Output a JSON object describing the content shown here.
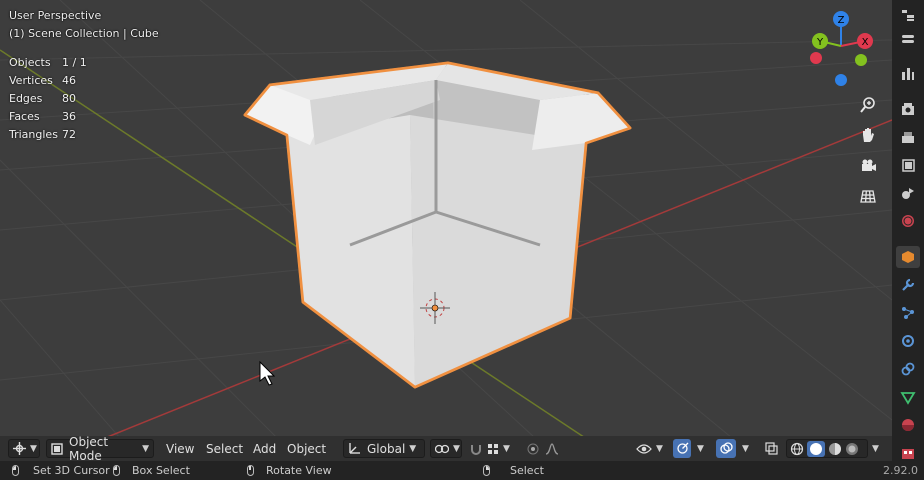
{
  "viewport": {
    "title": "User Perspective",
    "collection": "(1) Scene Collection | Cube",
    "stats": [
      {
        "label": "Objects",
        "value": "1 / 1"
      },
      {
        "label": "Vertices",
        "value": "46"
      },
      {
        "label": "Edges",
        "value": "80"
      },
      {
        "label": "Faces",
        "value": "36"
      },
      {
        "label": "Triangles",
        "value": "72"
      }
    ],
    "gizmo": {
      "z": "Z",
      "y": "Y",
      "x": "X"
    }
  },
  "header": {
    "mode": "Object Mode",
    "menus": [
      "View",
      "Select",
      "Add",
      "Object"
    ],
    "orientation": "Global"
  },
  "statusbar": {
    "left_click": "Set 3D Cursor",
    "left_drag": "Box Select",
    "middle": "Rotate View",
    "right": "Select",
    "version": "2.92.0"
  },
  "colors": {
    "background": "#3d3d3d",
    "selection_outline": "#f09040",
    "axis_x": "#a33a3a",
    "axis_y": "#6c7a2a",
    "gizmo_x": "#e0394e",
    "gizmo_y": "#83c11f",
    "gizmo_z": "#2f82e8",
    "header": "#303030",
    "statusbar": "#232323"
  },
  "icons": [
    "editor-type-icon",
    "object-mode-icon",
    "transform-orientation-icon",
    "pivot-icon",
    "snap-icon",
    "proportional-edit-icon",
    "visibility-icon",
    "gizmo-icon",
    "overlay-icon",
    "xray-icon",
    "wireframe-shading-icon",
    "solid-shading-icon",
    "material-shading-icon",
    "rendered-shading-icon",
    "zoom-icon",
    "hand-pan-icon",
    "camera-icon",
    "grid-icon",
    "tool-icon",
    "render-icon",
    "output-icon",
    "view-layer-icon",
    "scene-icon",
    "world-icon",
    "object-icon",
    "modifier-icon",
    "particles-icon",
    "physics-icon",
    "constraints-icon",
    "data-icon",
    "material-icon",
    "texture-icon"
  ]
}
